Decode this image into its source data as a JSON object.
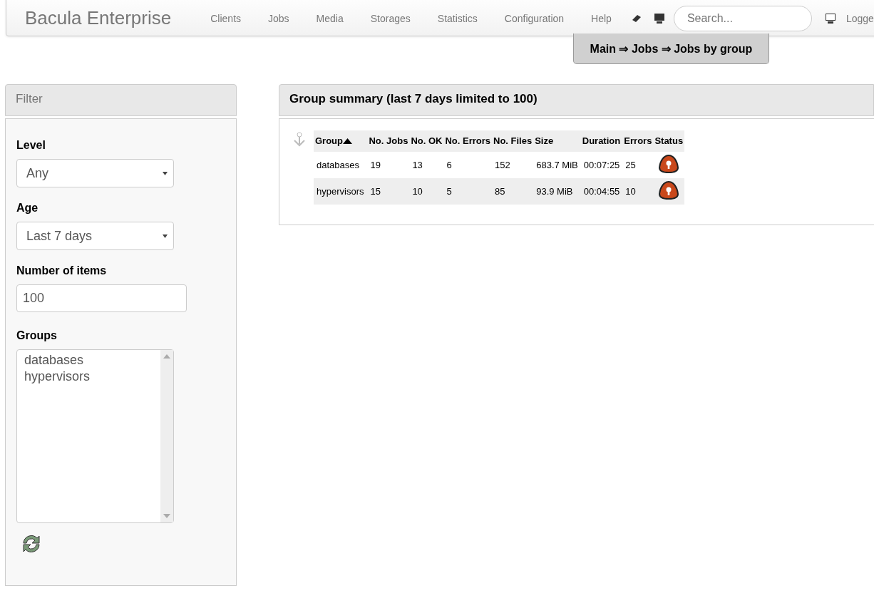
{
  "navbar": {
    "brand": "Bacula Enterprise",
    "menu": [
      {
        "label": "Clients"
      },
      {
        "label": "Jobs"
      },
      {
        "label": "Media"
      },
      {
        "label": "Storages"
      },
      {
        "label": "Statistics"
      },
      {
        "label": "Configuration"
      },
      {
        "label": "Help"
      }
    ],
    "search": {
      "placeholder": "Search..."
    },
    "user_label": "Logge"
  },
  "breadcrumb": "Main ⇒ Jobs ⇒ Jobs by group",
  "filter": {
    "title": "Filter",
    "level": {
      "label": "Level",
      "value": "Any"
    },
    "age": {
      "label": "Age",
      "value": "Last 7 days"
    },
    "items": {
      "label": "Number of items",
      "value": "100"
    },
    "groups": {
      "label": "Groups",
      "options": [
        {
          "label": "databases",
          "selected": false
        },
        {
          "label": "hypervisors",
          "selected": false
        }
      ]
    }
  },
  "summary": {
    "title": "Group summary (last 7 days limited to 100)",
    "columns": [
      {
        "label": "Group",
        "sorted": true
      },
      {
        "label": "No. Jobs",
        "sorted": false
      },
      {
        "label": "No. OK",
        "sorted": false
      },
      {
        "label": "No. Errors",
        "sorted": false
      },
      {
        "label": "No. Files",
        "sorted": false
      },
      {
        "label": "Size",
        "sorted": false
      },
      {
        "label": "Duration",
        "sorted": false
      },
      {
        "label": "Errors",
        "sorted": false
      },
      {
        "label": "Status",
        "sorted": false
      }
    ],
    "rows": [
      {
        "cells": [
          "databases",
          "19",
          "13",
          "6",
          "152",
          "683.7 MiB",
          "00:07:25",
          "25"
        ],
        "kind": "error"
      },
      {
        "cells": [
          "hypervisors",
          "15",
          "10",
          "5",
          "85",
          "93.9 MiB",
          "00:04:55",
          "10"
        ],
        "kind": "error"
      }
    ]
  }
}
